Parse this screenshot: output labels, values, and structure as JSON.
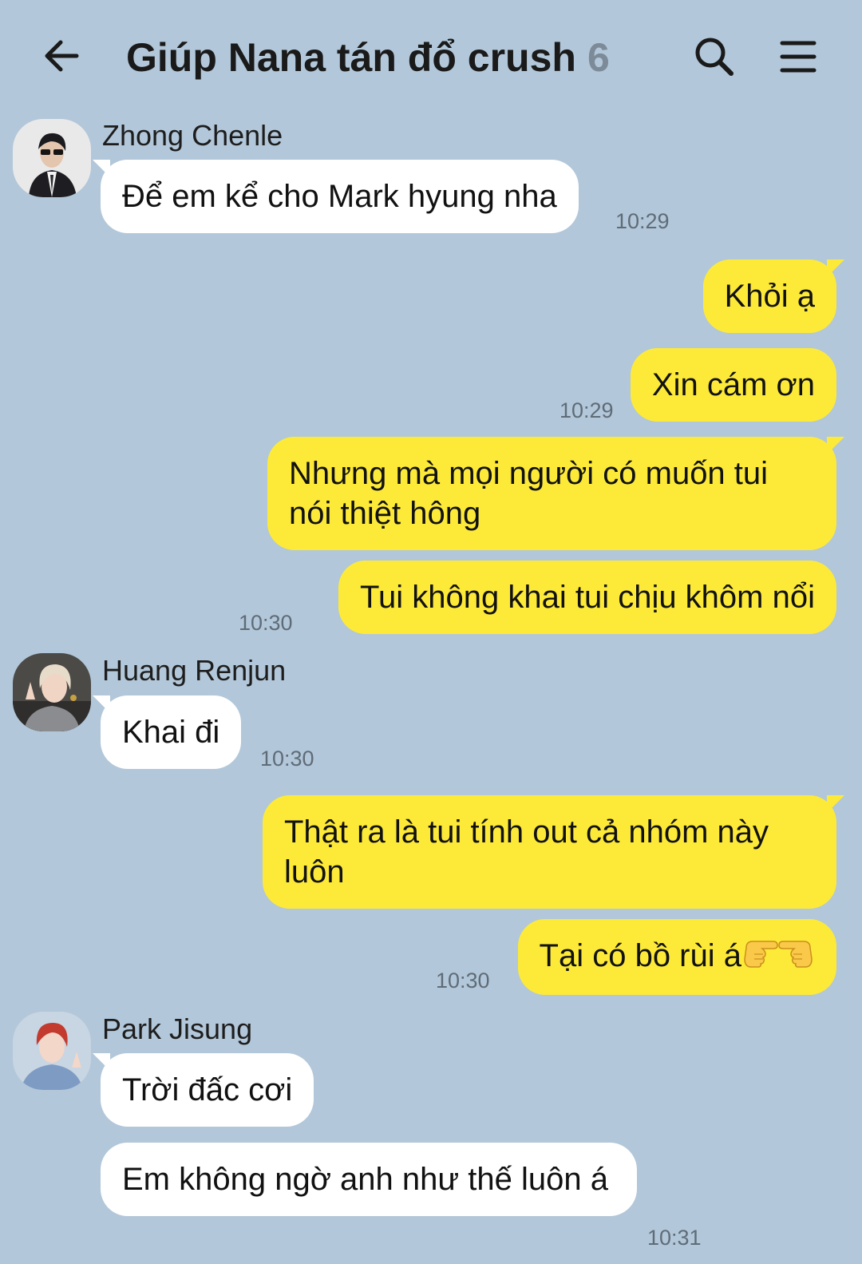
{
  "header": {
    "title": "Giúp Nana tán đổ crush",
    "member_count": "6"
  },
  "messages": [
    {
      "sender": "Zhong Chenle",
      "text": "Để em kể cho Mark hyung nha",
      "time": "10:29"
    },
    {
      "text": "Khỏi ạ"
    },
    {
      "text": "Xin cám ơn",
      "time": "10:29"
    },
    {
      "text": "Nhưng mà mọi người có muốn tui nói thiệt hông"
    },
    {
      "text": "Tui không khai tui chịu khôm nổi",
      "time": "10:30"
    },
    {
      "sender": "Huang Renjun",
      "text": "Khai đi",
      "time": "10:30"
    },
    {
      "text": "Thật ra là tui tính out cả nhóm này luôn"
    },
    {
      "text": "Tại có bồ rùi á",
      "emoji": [
        "backhand-index-pointing-right",
        "backhand-index-pointing-left"
      ],
      "time": "10:30"
    },
    {
      "sender": "Park Jisung",
      "text": "Trời đấc cơi"
    },
    {
      "text": "Em không ngờ anh như thế luôn á",
      "time": "10:31"
    }
  ],
  "icons": {
    "back": "arrow-left-icon",
    "search": "search-icon",
    "menu": "hamburger-menu-icon"
  },
  "colors": {
    "background": "#b2c7d9",
    "outgoing_bubble": "#fdea38",
    "incoming_bubble": "#ffffff"
  }
}
